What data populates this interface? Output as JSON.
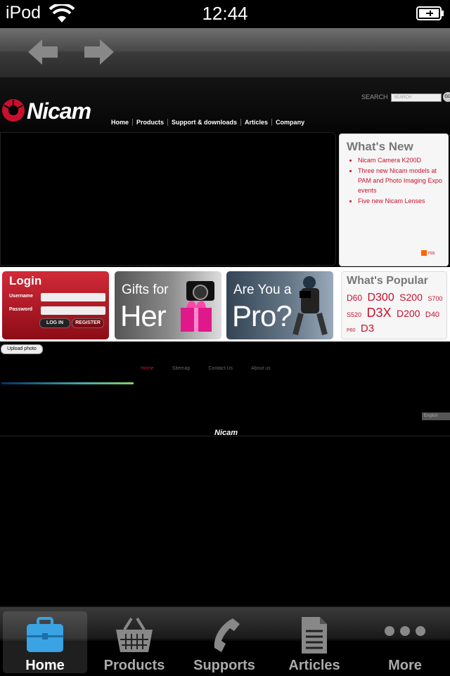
{
  "status_bar": {
    "carrier": "iPod",
    "time": "12:44"
  },
  "site": {
    "logo": "Nicam",
    "search_label": "SEARCH",
    "search_placeholder": "SEARCH",
    "search_button": "GO",
    "nav": [
      "Home",
      "Products",
      "Support & downloads",
      "Articles",
      "Company"
    ],
    "whats_new": {
      "title": "What's New",
      "items": [
        "Nicam Camera K200D",
        "Three new Nicam models at PAM and Photo Imaging Expo events",
        "Five new Nicam Lenses"
      ],
      "rss": "rss"
    },
    "login": {
      "title": "Login",
      "username_label": "Username",
      "password_label": "Password",
      "login_button": "LOG IN",
      "register_button": "REGISTER"
    },
    "promo1": {
      "small": "Gifts for",
      "big": "Her"
    },
    "promo2": {
      "small": "Are You a",
      "big": "Pro?"
    },
    "whats_popular": {
      "title": "What's Popular",
      "tags": [
        "D60",
        "D300",
        "S200",
        "S700",
        "S520",
        "D3X",
        "D200",
        "D40",
        "P60",
        "D3"
      ]
    },
    "upload_button": "Upload photo",
    "footer_nav": [
      "Home",
      "Sitemap",
      "Contact Us",
      "About us"
    ],
    "language": "English",
    "footer_logo": "Nicam"
  },
  "tabs": [
    {
      "label": "Home",
      "icon": "briefcase-icon",
      "selected": true
    },
    {
      "label": "Products",
      "icon": "basket-icon"
    },
    {
      "label": "Supports",
      "icon": "phone-icon"
    },
    {
      "label": "Articles",
      "icon": "document-icon"
    },
    {
      "label": "More",
      "icon": "more-icon"
    }
  ],
  "colors": {
    "accent_red": "#c8102e",
    "tab_selected": "#3aa3e3"
  }
}
